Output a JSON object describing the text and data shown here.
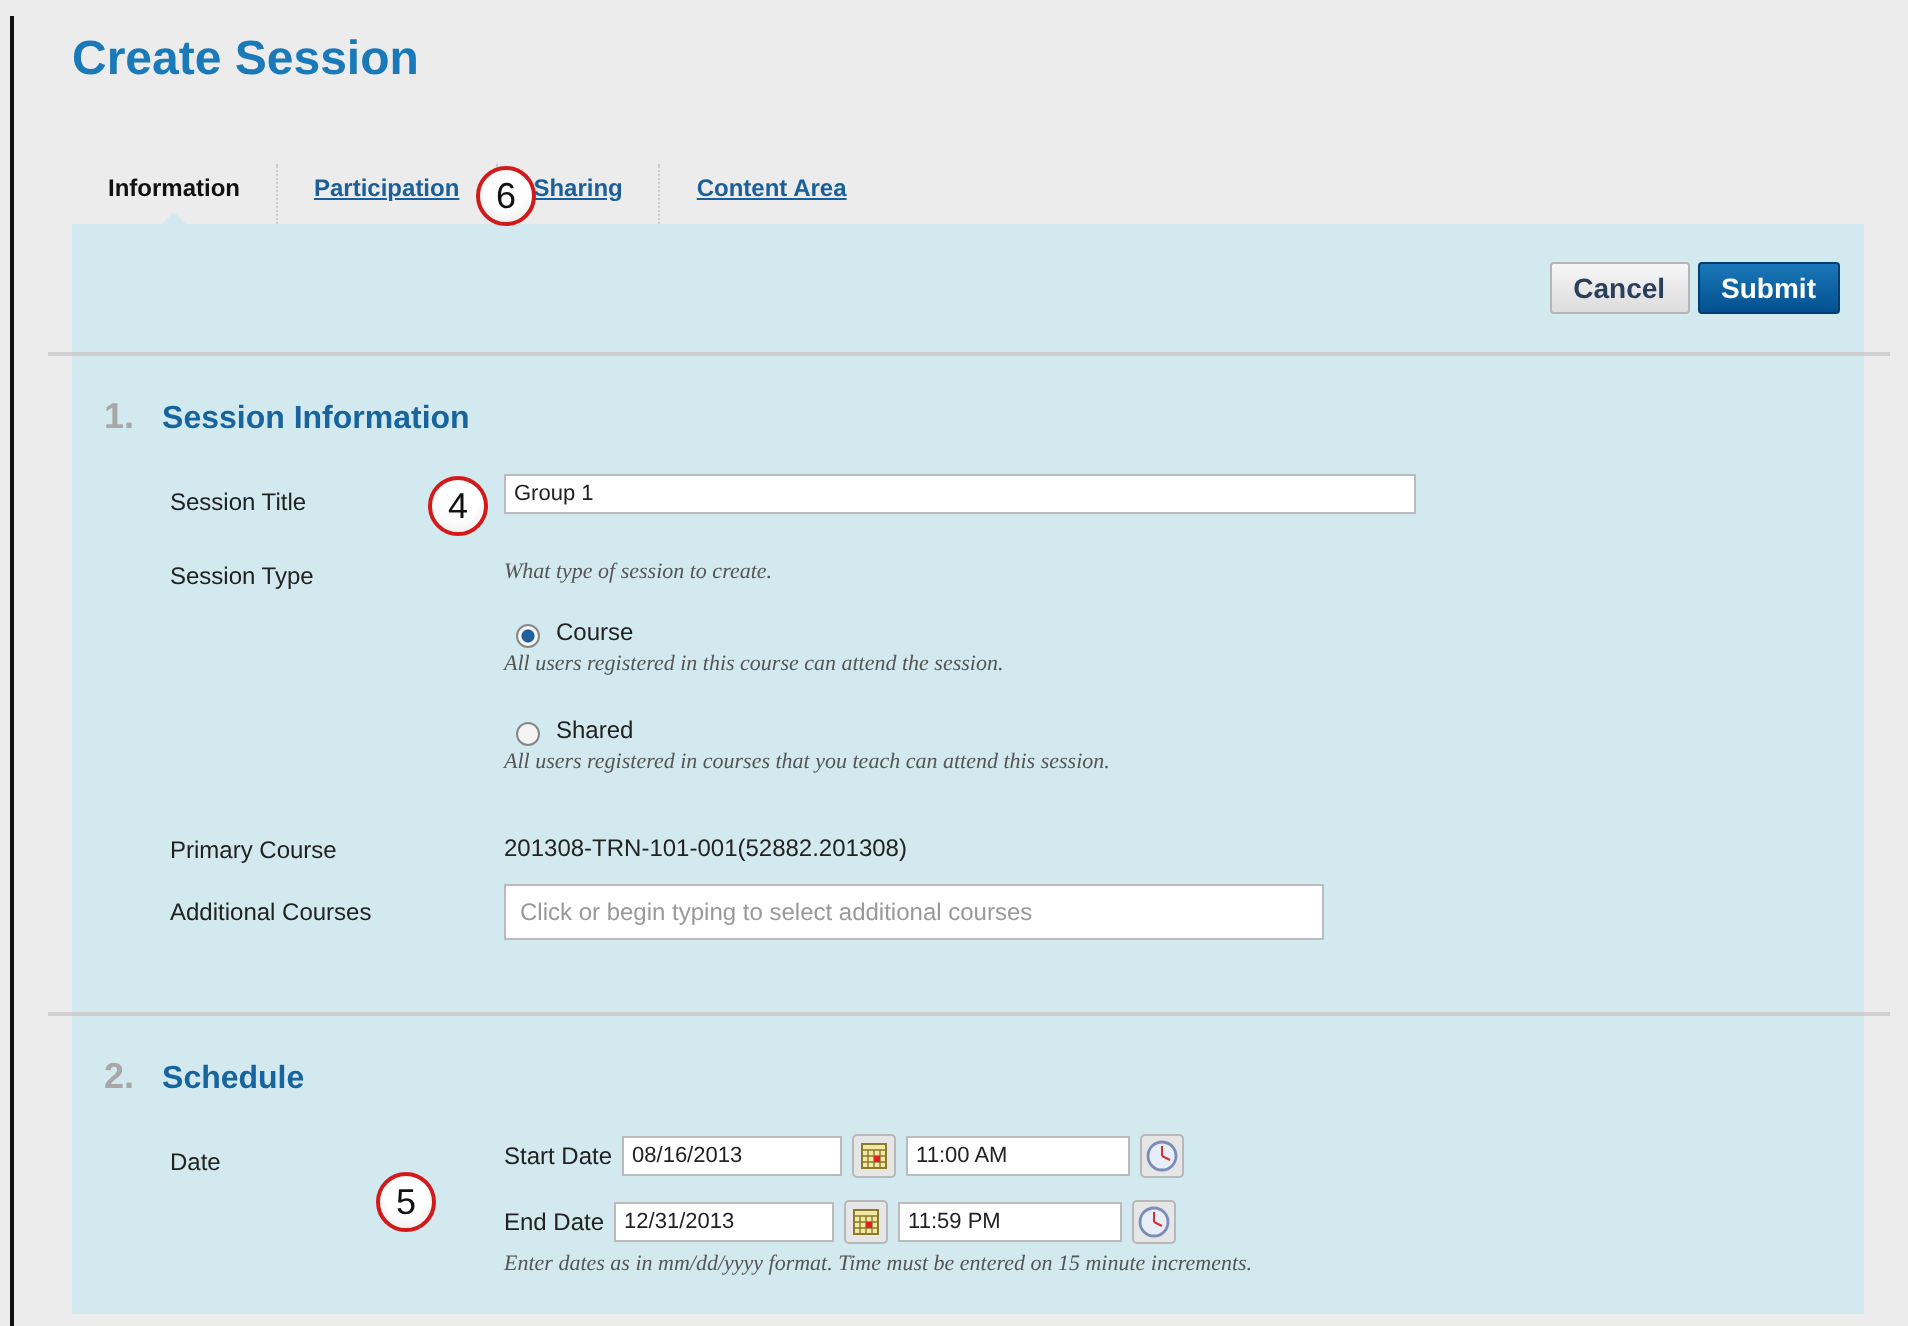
{
  "page_title": "Create Session",
  "tabs": [
    {
      "label": "Information",
      "selected": true
    },
    {
      "label": "Participation",
      "selected": false
    },
    {
      "label": "Sharing",
      "selected": false
    },
    {
      "label": "Content Area",
      "selected": false
    }
  ],
  "buttons": [
    {
      "label": "Cancel",
      "kind": "secondary"
    },
    {
      "label": "Submit",
      "kind": "primary"
    }
  ],
  "session_information": {
    "number": "1.",
    "title": "Session Information",
    "session_title": {
      "label": "Session Title",
      "value": "Group 1"
    },
    "session_type": {
      "label": "Session Type",
      "hint": "What type of session to create.",
      "options": [
        {
          "label": "Course",
          "description": "All users registered in this course can attend the session.",
          "selected": true
        },
        {
          "label": "Shared",
          "description": "All users registered in courses that you teach can attend this session.",
          "selected": false
        }
      ]
    },
    "primary_course": {
      "label": "Primary Course",
      "value": "201308-TRN-101-001(52882.201308)"
    },
    "additional_courses": {
      "label": "Additional Courses",
      "placeholder": "Click or begin typing to select additional courses"
    }
  },
  "schedule": {
    "number": "2.",
    "title": "Schedule",
    "date_label": "Date",
    "rows": [
      {
        "label": "Start Date",
        "date": "08/16/2013",
        "time": "11:00 AM"
      },
      {
        "label": "End Date",
        "date": "12/31/2013",
        "time": "11:59 PM"
      }
    ],
    "hint": "Enter dates as in mm/dd/yyyy format. Time must be entered on 15 minute increments."
  },
  "callouts": [
    {
      "label": "6",
      "kind": "tabs"
    },
    {
      "label": "4",
      "kind": "title"
    },
    {
      "label": "5",
      "kind": "schedule"
    }
  ]
}
